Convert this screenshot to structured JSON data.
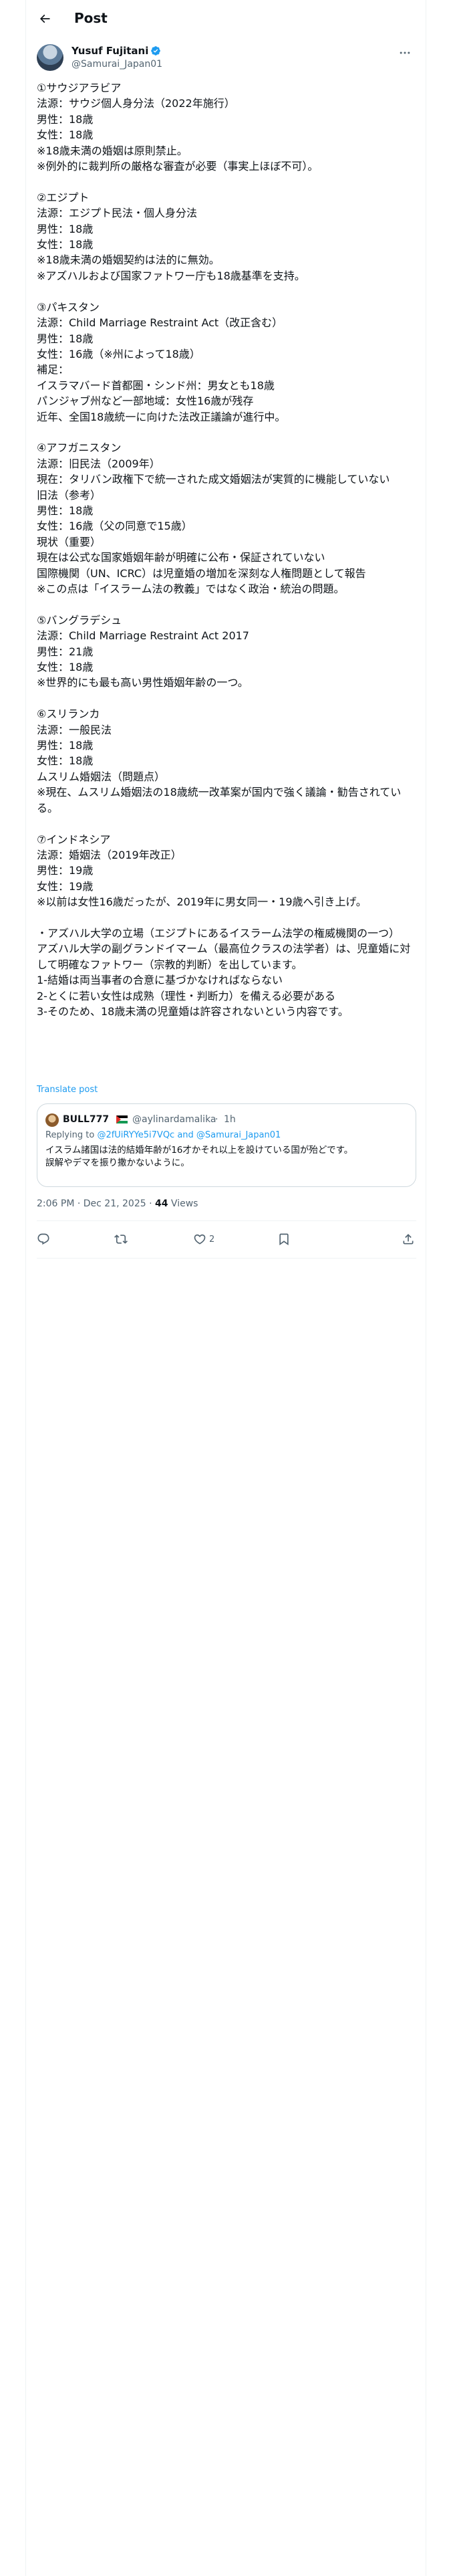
{
  "topbar": {
    "title": "Post"
  },
  "author": {
    "display_name": "Yusuf Fujitani",
    "handle": "@Samurai_Japan01",
    "verified": true
  },
  "post": {
    "paragraphs": [
      "①サウジアラビア\n法源：サウジ個人身分法（2022年施行）\n男性：18歳\n女性：18歳\n※18歳未満の婚姻は原則禁止。\n※例外的に裁判所の厳格な審査が必要（事実上ほぼ不可）。",
      "②エジプト\n法源：エジプト民法・個人身分法\n男性：18歳\n女性：18歳\n※18歳未満の婚姻契約は法的に無効。\n※アズハルおよび国家ファトワー庁も18歳基準を支持。",
      "③パキスタン\n法源：Child Marriage Restraint Act（改正含む）\n男性：18歳\n女性：16歳（※州によって18歳）\n補足：\nイスラマバード首都圏・シンド州：男女とも18歳\nパンジャブ州など一部地域：女性16歳が残存\n近年、全国18歳統一に向けた法改正議論が進行中。",
      "④アフガニスタン\n法源：旧民法（2009年）\n現在：タリバン政権下で統一された成文婚姻法が実質的に機能していない\n旧法（参考）\n男性：18歳\n女性：16歳（父の同意で15歳）\n現状（重要）\n現在は公式な国家婚姻年齢が明確に公布・保証されていない\n国際機関（UN、ICRC）は児童婚の増加を深刻な人権問題として報告\n※この点は「イスラーム法の教義」ではなく政治・統治の問題。",
      "⑤バングラデシュ\n法源：Child Marriage Restraint Act 2017\n男性：21歳\n女性：18歳\n※世界的にも最も高い男性婚姻年齢の一つ。",
      "⑥スリランカ\n法源：一般民法\n男性：18歳\n女性：18歳\nムスリム婚姻法（問題点）\n※現在、ムスリム婚姻法の18歳統一改革案が国内で強く議論・勧告されている。",
      "⑦インドネシア\n法源：婚姻法（2019年改正）\n男性：19歳\n女性：19歳\n※以前は女性16歳だったが、2019年に男女同一・19歳へ引き上げ。",
      "・アズハル大学の立場（エジプトにあるイスラーム法学の権威機関の一つ）\nアズハル大学の副グランドイマーム（最高位クラスの法学者）は、児童婚に対して明確なファトワー（宗教的判断）を出しています。\n1-結婚は両当事者の合意に基づかなければならない\n2-とくに若い女性は成熟（理性・判断力）を備える必要がある\n3-そのため、18歳未満の児童婚は許容されないという内容です。"
    ],
    "translate_label": "Translate post"
  },
  "quote": {
    "display_name": "BULL777",
    "handle": "@aylinardamalika",
    "separator": "·",
    "time": "1h",
    "reply_prefix": "Replying to ",
    "reply_handles": "@2fUiRYYe5i7VQc and @Samurai_Japan01",
    "text": "イスラム諸国は法的結婚年齢が16才かそれ以上を設けている国が殆どです。\n誤解やデマを振り撒かないように。"
  },
  "meta": {
    "timestamp": "2:06 PM · Dec 21, 2025 · ",
    "views_count": "44",
    "views_label": " Views"
  },
  "actions": {
    "reply_count": "",
    "repost_count": "",
    "like_count": "2",
    "bookmark_count": ""
  },
  "icons": {
    "back": "back-arrow-icon",
    "more": "more-icon",
    "verified": "verified-badge-icon",
    "reply": "reply-icon",
    "repost": "repost-icon",
    "like": "heart-icon",
    "bookmark": "bookmark-icon",
    "share": "share-icon"
  },
  "colors": {
    "accent": "#1d9bf0",
    "text": "#0f1419",
    "muted": "#536471",
    "border": "#eff3f4"
  }
}
